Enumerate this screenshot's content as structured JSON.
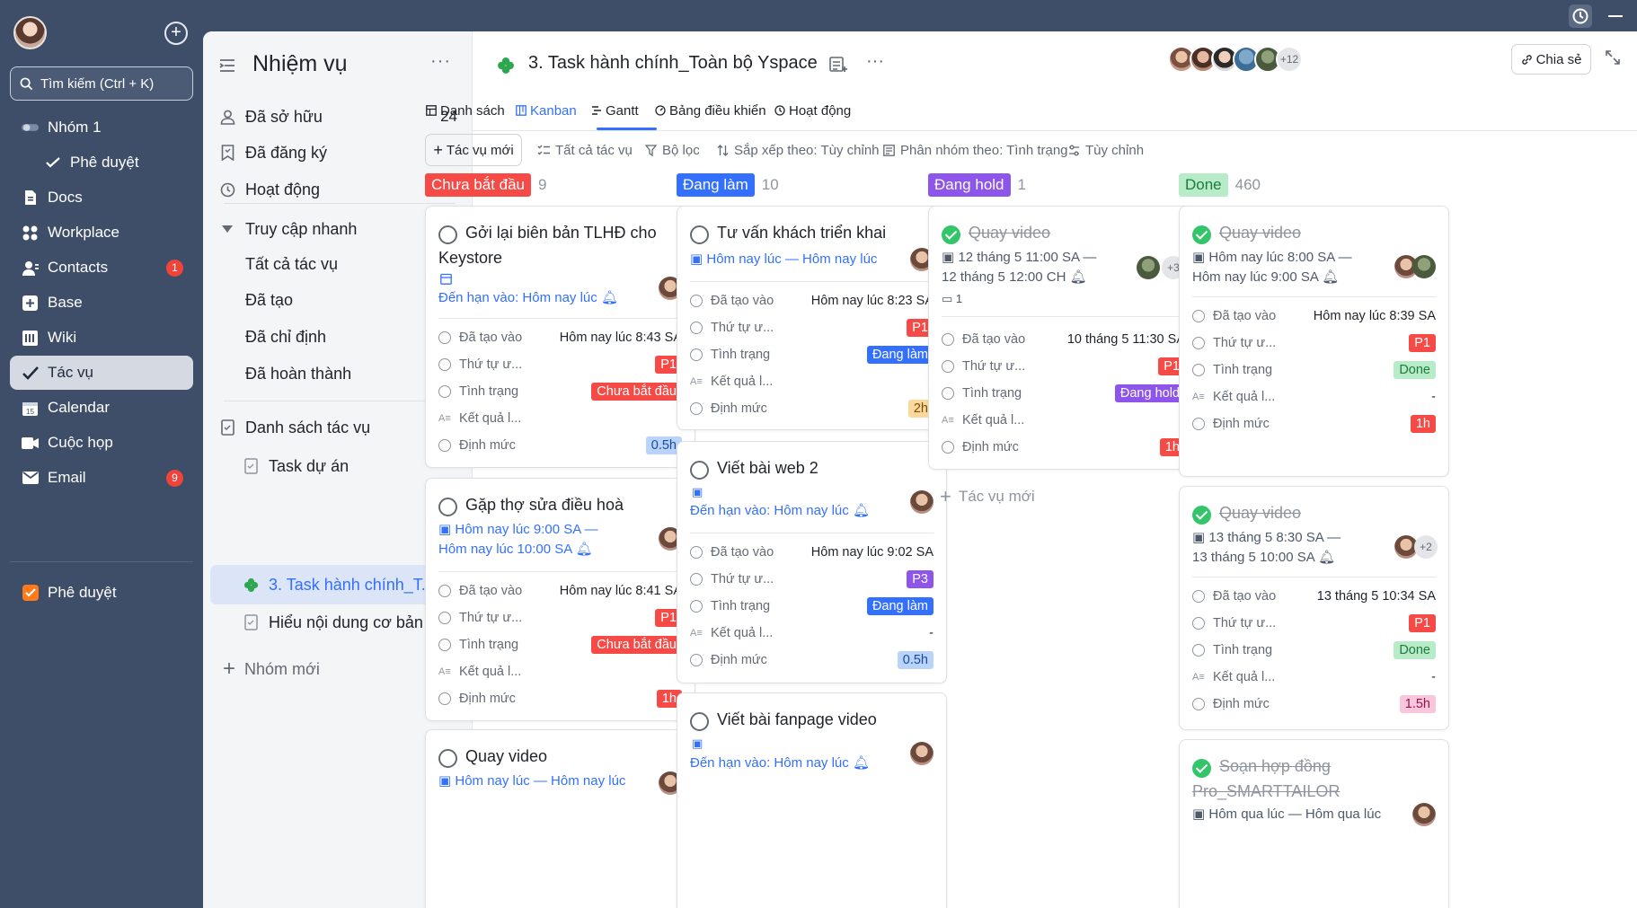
{
  "nav": {
    "search_label": "Tìm kiếm (Ctrl + K)",
    "items": [
      {
        "label": "Nhóm 1",
        "icon": "group-icon"
      },
      {
        "label": "Phê duyệt",
        "icon": "approval-check-icon"
      },
      {
        "label": "Docs",
        "icon": "docs-icon"
      },
      {
        "label": "Workplace",
        "icon": "workplace-icon"
      },
      {
        "label": "Contacts",
        "icon": "contacts-icon",
        "badge": "1"
      },
      {
        "label": "Base",
        "icon": "base-icon"
      },
      {
        "label": "Wiki",
        "icon": "wiki-icon"
      },
      {
        "label": "Tác vụ",
        "icon": "task-icon"
      },
      {
        "label": "Calendar",
        "icon": "calendar-icon"
      },
      {
        "label": "Cuộc họp",
        "icon": "meeting-icon"
      },
      {
        "label": "Email",
        "icon": "email-icon",
        "badge": "9"
      },
      {
        "label": "Phê duyệt",
        "icon": "approval-app-icon"
      }
    ]
  },
  "panel": {
    "title": "Nhiệm vụ",
    "owned_label": "Đã sở hữu",
    "owned_count": "24",
    "subscribed_label": "Đã đăng ký",
    "activity_label": "Hoạt động",
    "quick_access_label": "Truy cập nhanh",
    "quick": [
      "Tất cả tác vụ",
      "Đã tạo",
      "Đã chỉ định",
      "Đã hoàn thành"
    ],
    "lists_label": "Danh sách tác vụ",
    "lists": [
      "Task dự án",
      "3. Task hành chính_T...",
      "Hiểu nội dung cơ bản ..."
    ],
    "new_group_label": "Nhóm mới"
  },
  "board": {
    "title": "3. Task hành chính_Toàn bộ Yspace",
    "member_more": "+12",
    "share_label": "Chia sẻ",
    "tabs": [
      "Danh sách",
      "Kanban",
      "Gantt",
      "Bảng điều khiển",
      "Hoạt động"
    ],
    "active_tab": "Kanban",
    "toolbar": {
      "new_task": "Tác vụ mới",
      "all_tasks": "Tất cả tác vụ",
      "filter": "Bộ lọc",
      "sort": "Sắp xếp theo: Tùy chỉnh",
      "group": "Phân nhóm theo: Tình trạng",
      "customize": "Tùy chỉnh"
    },
    "field_labels": {
      "created": "Đã tạo vào",
      "priority": "Thứ tự ư...",
      "status": "Tình trạng",
      "result": "Kết quả l...",
      "estimate": "Định mức"
    },
    "new_task_in_column": "Tác vụ mới",
    "columns": [
      {
        "label": "Chưa bắt đầu",
        "count": "9",
        "color": "#f54a45"
      },
      {
        "label": "Đang làm",
        "count": "10",
        "color": "#3370ff"
      },
      {
        "label": "Đang hold",
        "count": "1",
        "color": "#8d55ea"
      },
      {
        "label": "Done",
        "count": "460",
        "color": "#b8ecc9"
      }
    ],
    "cards": {
      "c1": {
        "title": "Gởi lại biên bản TLHĐ cho Keystore",
        "due": "Đến hạn vào: Hôm nay lúc",
        "created": "Hôm nay lúc 8:43 SA",
        "priority": "P1",
        "status": "Chưa bắt đầu",
        "result": "-",
        "estimate": "0.5h"
      },
      "c2": {
        "title": "Gặp thợ sửa điều hoà",
        "date1": "Hôm nay lúc 9:00 SA  —",
        "date2": "Hôm nay lúc 10:00 SA",
        "created": "Hôm nay lúc 8:41 SA",
        "priority": "P1",
        "status": "Chưa bắt đầu",
        "result": "-",
        "estimate": "1h"
      },
      "c3": {
        "title": "Quay video",
        "date1": "Hôm nay lúc  —  Hôm nay lúc"
      },
      "c4": {
        "title": "Tư vấn khách triển khai",
        "date1": "Hôm nay lúc  —  Hôm nay lúc",
        "created": "Hôm nay lúc 8:23 SA",
        "priority": "P1",
        "status": "Đang làm",
        "result": "-",
        "estimate": "2h"
      },
      "c5": {
        "title": "Viết bài web 2",
        "due": "Đến hạn vào: Hôm nay lúc",
        "created": "Hôm nay lúc 9:02 SA",
        "priority": "P3",
        "status": "Đang làm",
        "result": "-",
        "estimate": "0.5h"
      },
      "c6": {
        "title": "Viết bài fanpage video",
        "due": "Đến hạn vào: Hôm nay lúc"
      },
      "c7": {
        "title": "Quay video",
        "date1": "12 tháng 5 11:00 SA  —",
        "date2": "12 tháng 5 12:00 CH",
        "comments": "1",
        "more": "+3",
        "created": "10 tháng 5 11:30 SA",
        "priority": "P1",
        "status": "Đang hold",
        "result": "-",
        "estimate": "1h"
      },
      "c8": {
        "title": "Quay video",
        "date1": "Hôm nay lúc 8:00 SA  —",
        "date2": "Hôm nay lúc 9:00 SA",
        "created": "Hôm nay lúc 8:39 SA",
        "priority": "P1",
        "status": "Done",
        "result": "-",
        "estimate": "1h"
      },
      "c9": {
        "title": "Quay video",
        "date1": "13 tháng 5 8:30 SA  —",
        "date2": "13 tháng 5 10:00 SA",
        "more": "+2",
        "created": "13 tháng 5 10:34 SA",
        "priority": "P1",
        "status": "Done",
        "result": "-",
        "estimate": "1.5h"
      },
      "c10": {
        "title": "Soạn hợp đồng Pro_SMARTTAILOR",
        "date1": "Hôm qua lúc  —  Hôm qua lúc"
      }
    }
  }
}
